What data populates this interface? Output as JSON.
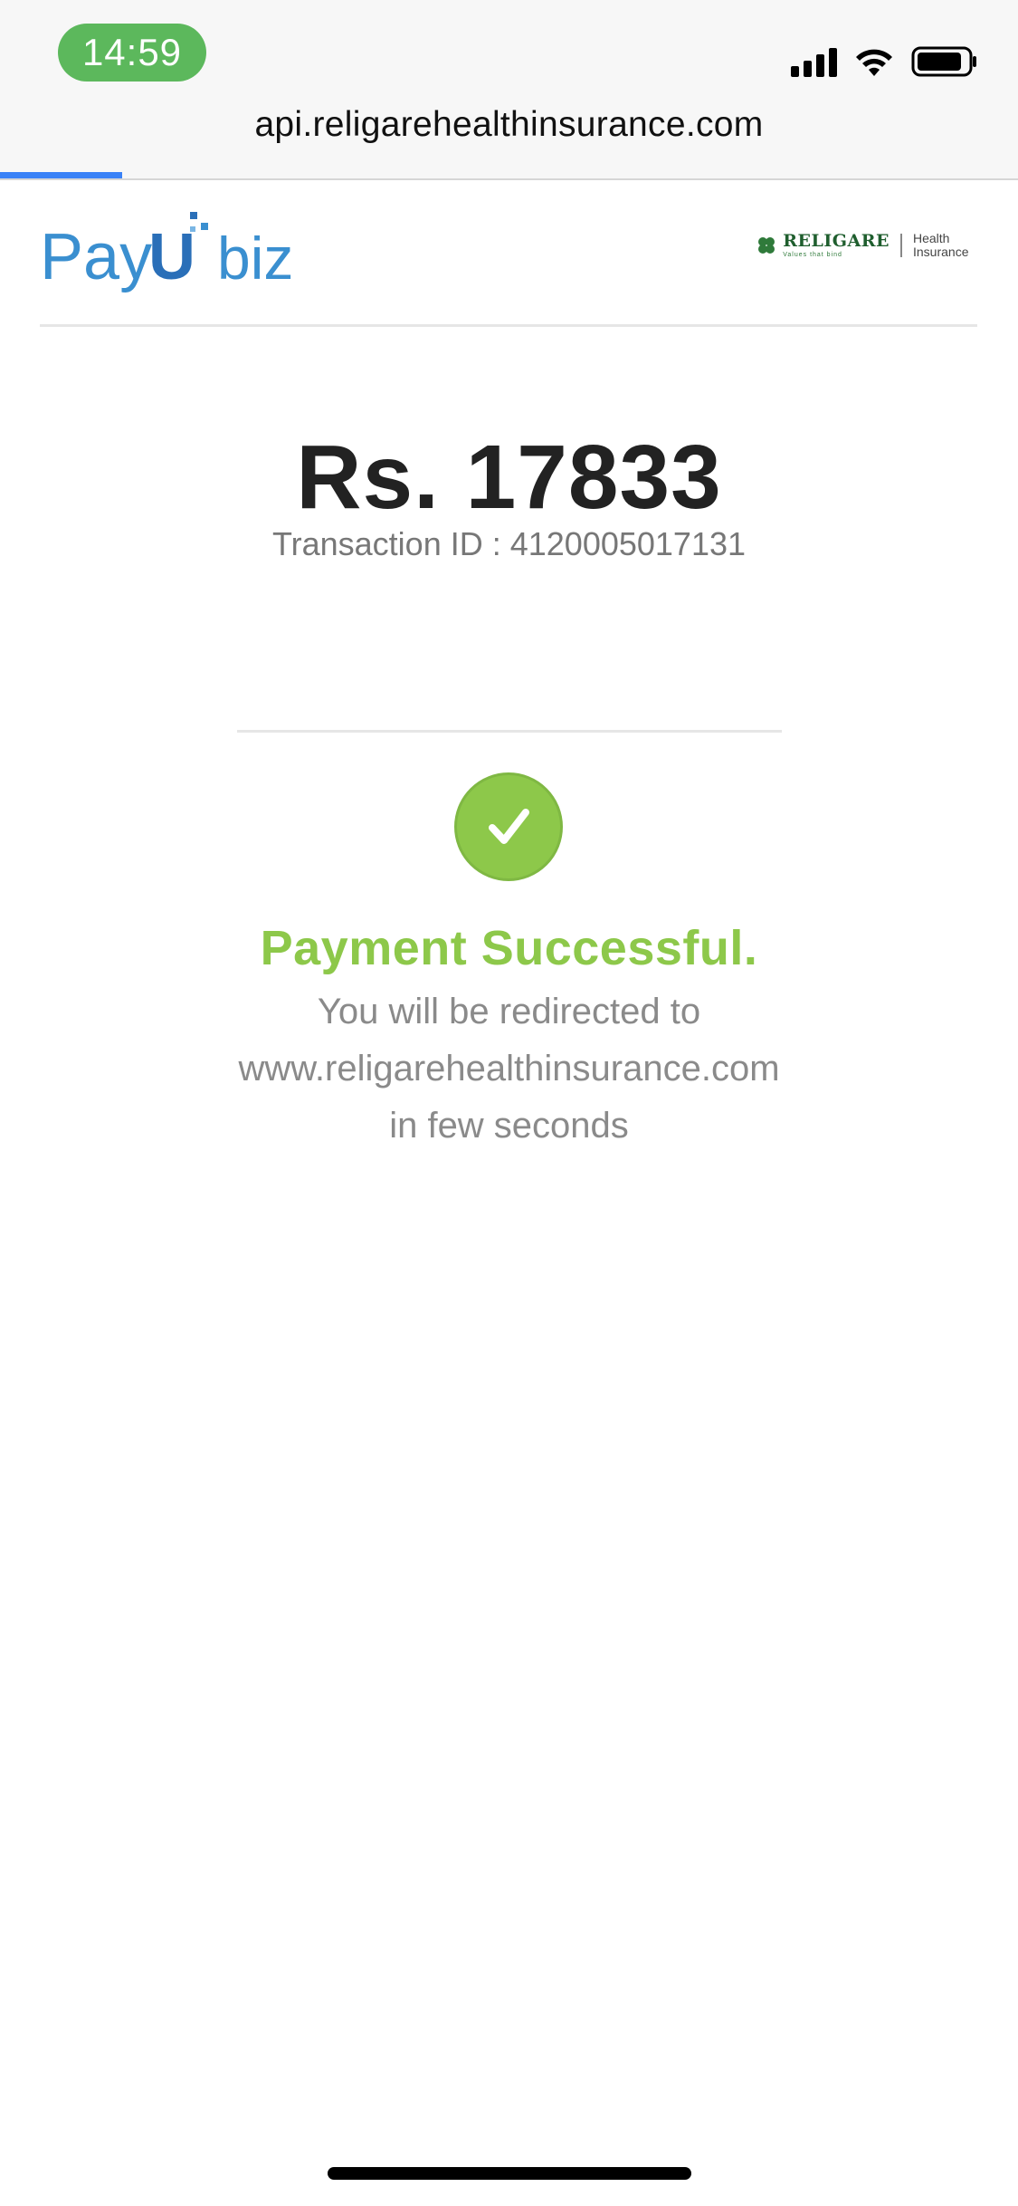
{
  "status_bar": {
    "time": "14:59"
  },
  "browser": {
    "url": "api.religarehealthinsurance.com",
    "load_progress": 0.12
  },
  "header": {
    "payu_logo_text": "PayU biz",
    "religare_logo_text": "RELIGARE",
    "religare_tagline": "Values that bind",
    "religare_sub": "Health Insurance"
  },
  "payment": {
    "amount": "Rs. 17833",
    "transaction_id": "Transaction ID : 4120005017131",
    "status": "Payment Successful.",
    "redirect_line1": "You will be redirected to",
    "redirect_line2": "www.religarehealthinsurance.com",
    "redirect_line3": "in few seconds"
  },
  "colors": {
    "success_green": "#8dc84a",
    "payu_blue": "#3a8fd0",
    "religare_green": "#1f5e2e",
    "progress_blue": "#3a82f7",
    "time_pill": "#5cb85c"
  },
  "icons": [
    "cellular-signal-icon",
    "wifi-icon",
    "battery-icon",
    "checkmark-icon",
    "religare-clover-icon"
  ]
}
